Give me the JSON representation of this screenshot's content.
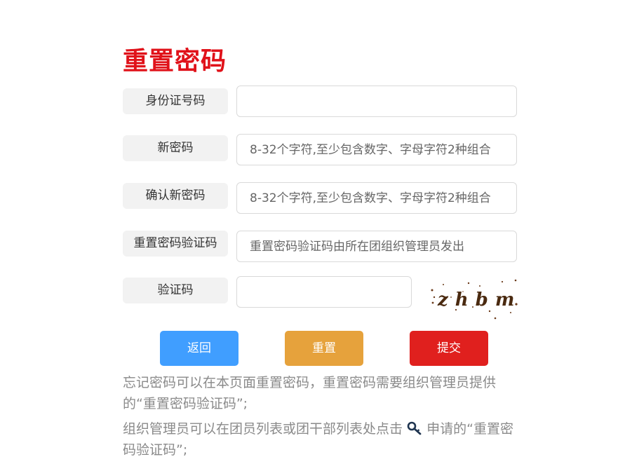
{
  "page": {
    "title": "重置密码"
  },
  "form": {
    "id_label": "身份证号码",
    "id_placeholder": "",
    "new_pw_label": "新密码",
    "new_pw_placeholder": "8-32个字符,至少包含数字、字母字符2种组合",
    "confirm_label": "确认新密码",
    "confirm_placeholder": "8-32个字符,至少包含数字、字母字符2种组合",
    "reset_code_label": "重置密码验证码",
    "reset_code_placeholder": "重置密码验证码由所在团组织管理员发出",
    "captcha_label": "验证码",
    "captcha_placeholder": "",
    "captcha_text": "zhbm"
  },
  "buttons": {
    "back": "返回",
    "reset": "重置",
    "submit": "提交"
  },
  "colors": {
    "title": "#e0121a",
    "back": "#409eff",
    "reset": "#e6a23c",
    "submit": "#e0201e"
  },
  "notes": {
    "line1": "忘记密码可以在本页面重置密码，重置密码需要组织管理员提供的“重置密码验证码”;",
    "line2_before": "组织管理员可以在团员列表或团干部列表处点击",
    "line2_icon": "key-icon",
    "line2_after": "申请的“重置密码验证码”;"
  }
}
